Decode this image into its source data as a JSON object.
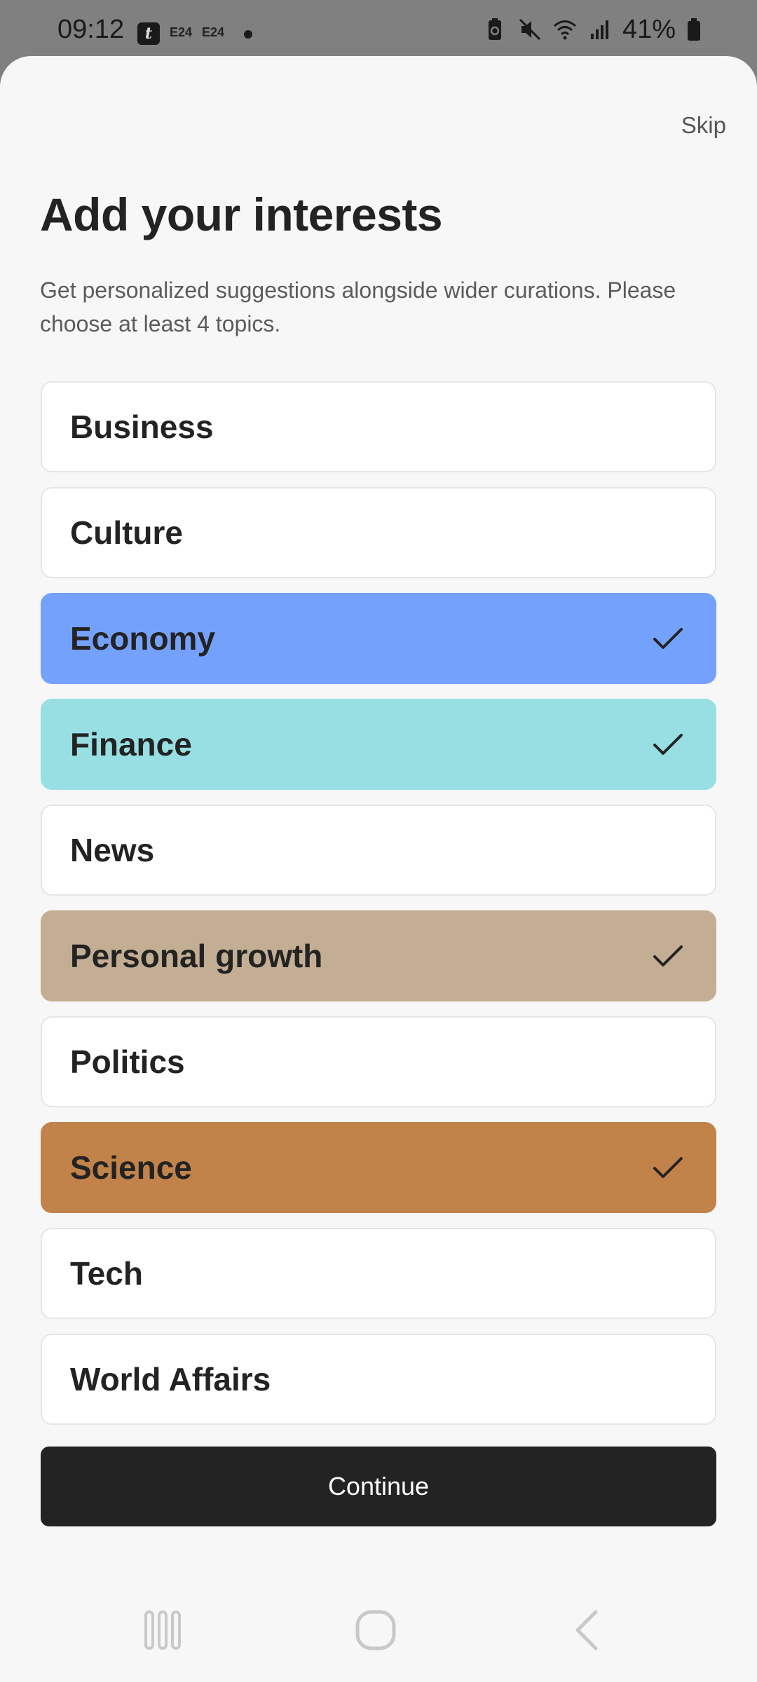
{
  "status_bar": {
    "time": "09:12",
    "app_icons": [
      "t",
      "E24",
      "E24"
    ],
    "battery": "41%"
  },
  "header": {
    "skip_label": "Skip",
    "title": "Add your interests",
    "subtitle": "Get personalized suggestions alongside wider curations. Please choose at least 4 topics."
  },
  "topics": [
    {
      "label": "Business",
      "selected": false,
      "color": "#ffffff"
    },
    {
      "label": "Culture",
      "selected": false,
      "color": "#ffffff"
    },
    {
      "label": "Economy",
      "selected": true,
      "color": "#74a1fb"
    },
    {
      "label": "Finance",
      "selected": true,
      "color": "#97dfe3"
    },
    {
      "label": "News",
      "selected": false,
      "color": "#ffffff"
    },
    {
      "label": "Personal growth",
      "selected": true,
      "color": "#c4ae93"
    },
    {
      "label": "Politics",
      "selected": false,
      "color": "#ffffff"
    },
    {
      "label": "Science",
      "selected": true,
      "color": "#c2834b"
    },
    {
      "label": "Tech",
      "selected": false,
      "color": "#ffffff"
    },
    {
      "label": "World Affairs",
      "selected": false,
      "color": "#ffffff"
    }
  ],
  "continue_label": "Continue",
  "colors": {
    "sheet_background": "#f7f7f7",
    "status_bar_background": "#808080",
    "primary_button": "#232323"
  },
  "icons": {
    "selected_marker": "check-icon",
    "nav": [
      "recents-icon",
      "home-icon",
      "back-icon"
    ]
  }
}
